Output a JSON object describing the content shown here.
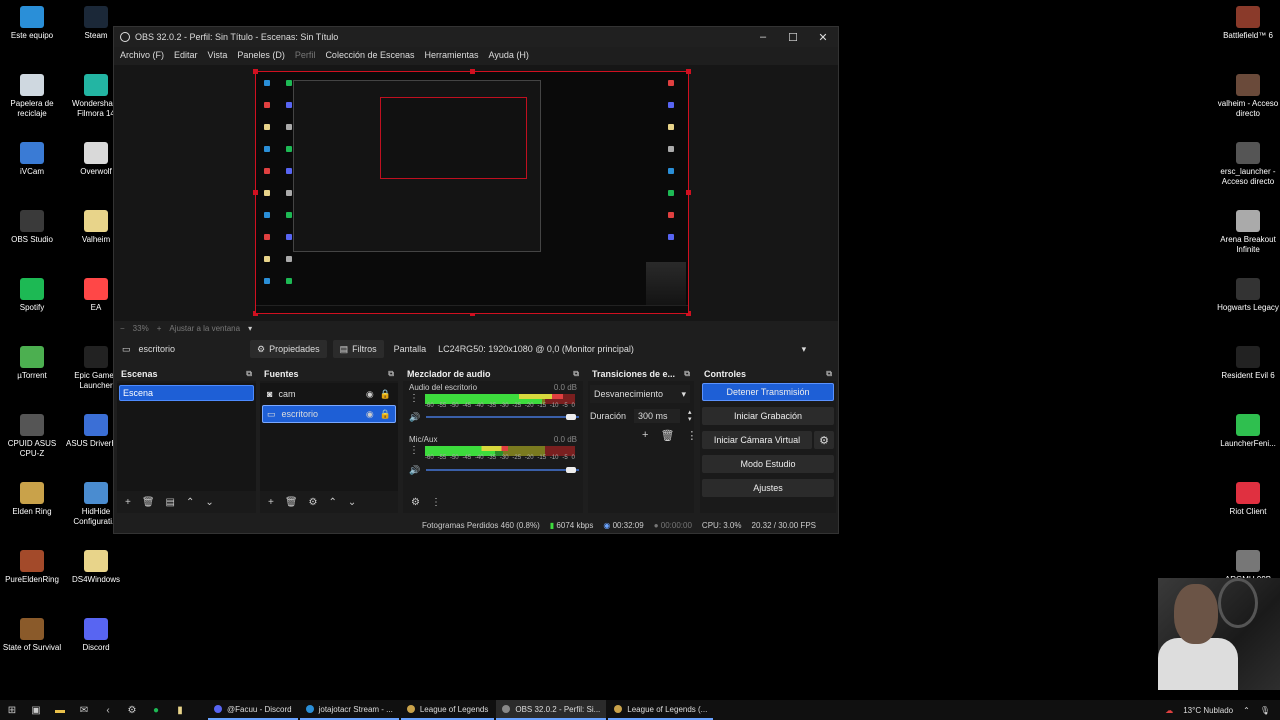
{
  "desktop_left": [
    {
      "label": "Este equipo",
      "color": "#2a8fd8"
    },
    {
      "label": "Steam",
      "color": "#1b2838"
    },
    {
      "label": "Papelera de reciclaje",
      "color": "#cfd8e0"
    },
    {
      "label": "Wondershare Filmora 14",
      "color": "#23b5a3"
    },
    {
      "label": "iVCam",
      "color": "#3a7bd5"
    },
    {
      "label": "Overwolf",
      "color": "#d9d9d9"
    },
    {
      "label": "OBS Studio",
      "color": "#3a3a3a"
    },
    {
      "label": "Valheim",
      "color": "#e8d48a"
    },
    {
      "label": "Spotify",
      "color": "#1db954"
    },
    {
      "label": "EA",
      "color": "#ff4747"
    },
    {
      "label": "µTorrent",
      "color": "#4caf50"
    },
    {
      "label": "Epic Games Launcher",
      "color": "#222"
    },
    {
      "label": "CPUID ASUS CPU-Z",
      "color": "#555"
    },
    {
      "label": "ASUS DriverHub",
      "color": "#3b6fd6"
    },
    {
      "label": "Elden Ring",
      "color": "#c9a24a"
    },
    {
      "label": "HidHide Configurati...",
      "color": "#4a8cd0"
    },
    {
      "label": "PureEldenRing",
      "color": "#a34a2a"
    },
    {
      "label": "DS4Windows",
      "color": "#e8d48a"
    },
    {
      "label": "State of Survival",
      "color": "#8a5a2a"
    },
    {
      "label": "Discord",
      "color": "#5865f2"
    }
  ],
  "desktop_right": [
    {
      "label": "Battlefield™ 6",
      "color": "#8a3a2a"
    },
    {
      "label": "valheim - Acceso directo",
      "color": "#6a4a3a"
    },
    {
      "label": "ersc_launcher - Acceso directo",
      "color": "#555"
    },
    {
      "label": "Arena Breakout Infinite",
      "color": "#aaa"
    },
    {
      "label": "Hogwarts Legacy",
      "color": "#333"
    },
    {
      "label": "Resident Evil 6",
      "color": "#222"
    },
    {
      "label": "LauncherFeni...",
      "color": "#2fbf4f"
    },
    {
      "label": "Riot Client",
      "color": "#e03040"
    },
    {
      "label": "ARGMU 99B",
      "color": "#777"
    }
  ],
  "obs": {
    "title": "OBS 32.0.2 - Perfil: Sin Título - Escenas: Sin Título",
    "menu": [
      "Archivo (F)",
      "Editar",
      "Vista",
      "Paneles (D)",
      "Perfil",
      "Colección de Escenas",
      "Herramientas",
      "Ayuda (H)"
    ],
    "zoom": "33%",
    "fit_label": "Ajustar a la ventana",
    "selected_source_name": "escritorio",
    "properties_label": "Propiedades",
    "filters_label": "Filtros",
    "display_label": "Pantalla",
    "monitor": "LC24RG50: 1920x1080 @ 0,0 (Monitor principal)",
    "scenes_title": "Escenas",
    "scenes": [
      "Escena"
    ],
    "sources_title": "Fuentes",
    "sources": [
      {
        "name": "cam",
        "icon": "camera-icon",
        "selected": false
      },
      {
        "name": "escritorio",
        "icon": "monitor-icon",
        "selected": true
      }
    ],
    "mixer_title": "Mezclador de audio",
    "channels": [
      {
        "name": "Audio del escritorio",
        "db": "0.0 dB",
        "level": 0.92,
        "volume": 0.98
      },
      {
        "name": "Mic/Aux",
        "db": "0.0 dB",
        "level": 0.55,
        "volume": 0.98
      }
    ],
    "meter_scale": [
      "-60",
      "-55",
      "-50",
      "-45",
      "-40",
      "-35",
      "-30",
      "-25",
      "-20",
      "-15",
      "-10",
      "-5",
      "0"
    ],
    "transitions_title": "Transiciones de e...",
    "transition": "Desvanecimiento",
    "duration_label": "Duración",
    "duration": "300 ms",
    "controls_title": "Controles",
    "controls": {
      "stop_stream": "Detener Transmisión",
      "start_recording": "Iniciar Grabación",
      "start_virtual_cam": "Iniciar Cámara Virtual",
      "studio_mode": "Modo Estudio",
      "settings": "Ajustes"
    },
    "status": {
      "dropped": "Fotogramas Perdidos 460 (0.8%)",
      "bitrate": "6074 kbps",
      "stream_time": "00:32:09",
      "rec_time": "00:00:00",
      "cpu": "CPU: 3.0%",
      "fps": "20.32 / 30.00 FPS"
    }
  },
  "taskbar": {
    "tasks": [
      {
        "label": "@Facuu - Discord",
        "color": "#5865f2",
        "active": false
      },
      {
        "label": "jotajotacr Stream - ...",
        "color": "#2a8fd8",
        "active": false
      },
      {
        "label": "League of Legends",
        "color": "#c9a24a",
        "active": false
      },
      {
        "label": "OBS 32.0.2 - Perfil: Si...",
        "color": "#888",
        "active": true
      },
      {
        "label": "League of Legends (...",
        "color": "#c9a24a",
        "active": false
      }
    ],
    "weather": "13°C Nublado"
  }
}
